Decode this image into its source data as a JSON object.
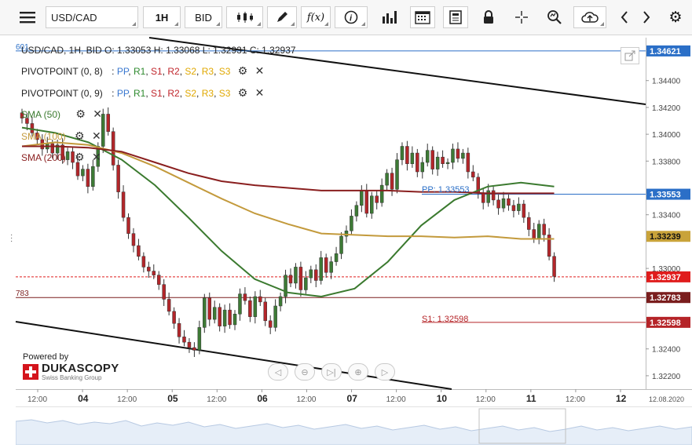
{
  "toolbar": {
    "symbol": "USD/CAD",
    "timeframe": "1H",
    "side": "BID",
    "fx_label": "f(x)"
  },
  "chart_header": {
    "info": "USD/CAD, 1H, BID   O: 1.33053 H: 1.33068 L: 1.32931 C: 1.32937",
    "pivot1_name": "PIVOTPOINT (0, 8)",
    "pivot2_name": "PIVOTPOINT (0, 9)",
    "pivot_levels": [
      {
        "label": "PP",
        "color": "#3a78d0"
      },
      {
        "label": "R1",
        "color": "#2f8a2f"
      },
      {
        "label": "S1",
        "color": "#c0262c"
      },
      {
        "label": "R2",
        "color": "#c0262c"
      },
      {
        "label": "S2",
        "color": "#e0a800"
      },
      {
        "label": "R3",
        "color": "#e0a800"
      },
      {
        "label": "S3",
        "color": "#e0a800"
      }
    ],
    "sma50": "SMA (50)",
    "sma100": "SMA (100)",
    "sma200": "SMA (200)"
  },
  "price_axis": {
    "ticks": [
      "1.34400",
      "1.34200",
      "1.34000",
      "1.33800",
      "1.33400",
      "1.33000",
      "1.32400",
      "1.32200"
    ],
    "tags": [
      {
        "text": "1.34621",
        "value": 1.34621,
        "bg": "#2b6fc7",
        "fg": "#ffffff"
      },
      {
        "text": "1.33553",
        "value": 1.33553,
        "bg": "#2b6fc7",
        "fg": "#ffffff"
      },
      {
        "text": "1.33239",
        "value": 1.33239,
        "bg": "#c9a33a",
        "fg": "#111111"
      },
      {
        "text": "1.32937",
        "value": 1.32937,
        "bg": "#e01c1c",
        "fg": "#ffffff"
      },
      {
        "text": "1.32783",
        "value": 1.32783,
        "bg": "#7a1d1d",
        "fg": "#ffffff"
      },
      {
        "text": "1.32598",
        "value": 1.32598,
        "bg": "#b52428",
        "fg": "#ffffff"
      }
    ]
  },
  "level_labels": {
    "pp": "PP: 1.33553",
    "s1": "S1: 1.32598",
    "left_cut_top": "601",
    "left_cut_mid": "783"
  },
  "time_axis": {
    "labels": [
      "12:00",
      "04",
      "12:00",
      "05",
      "12:00",
      "06",
      "12:00",
      "07",
      "12:00",
      "10",
      "12:00",
      "11",
      "12:00",
      "12"
    ],
    "date_right": "12.08.2020"
  },
  "branding": {
    "powered": "Powered by",
    "name": "DUKASCOPY",
    "sub": "Swiss Banking Group"
  },
  "chart_data": {
    "type": "candlestick",
    "title": "USD/CAD, 1H, BID",
    "ohlc_last": {
      "open": 1.33053,
      "high": 1.33068,
      "low": 1.32931,
      "close": 1.32937
    },
    "ylim": [
      1.321,
      1.3472
    ],
    "x_ticks": [
      "12:00",
      "04",
      "12:00",
      "05",
      "12:00",
      "06",
      "12:00",
      "07",
      "12:00",
      "10",
      "12:00",
      "11",
      "12:00",
      "12"
    ],
    "closes": [
      1.3412,
      1.3408,
      1.3401,
      1.3396,
      1.3389,
      1.3393,
      1.3386,
      1.3392,
      1.3381,
      1.3387,
      1.3379,
      1.3369,
      1.3374,
      1.3361,
      1.3376,
      1.3391,
      1.3415,
      1.3402,
      1.3377,
      1.3357,
      1.3338,
      1.3326,
      1.3317,
      1.3309,
      1.3301,
      1.3298,
      1.3295,
      1.3288,
      1.3277,
      1.3268,
      1.3259,
      1.3249,
      1.3245,
      1.3241,
      1.3239,
      1.3256,
      1.3278,
      1.3262,
      1.3271,
      1.3257,
      1.3269,
      1.3258,
      1.3266,
      1.3281,
      1.3276,
      1.3264,
      1.3279,
      1.3275,
      1.3261,
      1.3256,
      1.3272,
      1.3279,
      1.3295,
      1.3289,
      1.3301,
      1.3284,
      1.3293,
      1.3299,
      1.3291,
      1.3308,
      1.3297,
      1.3305,
      1.3311,
      1.3324,
      1.3328,
      1.3339,
      1.3347,
      1.3358,
      1.3341,
      1.3354,
      1.3349,
      1.3362,
      1.3371,
      1.3359,
      1.3381,
      1.3391,
      1.3378,
      1.3386,
      1.3372,
      1.3379,
      1.3388,
      1.3374,
      1.3383,
      1.3378,
      1.3379,
      1.3389,
      1.3382,
      1.3386,
      1.3372,
      1.3368,
      1.3356,
      1.3349,
      1.3358,
      1.3351,
      1.3345,
      1.3352,
      1.3347,
      1.3343,
      1.3348,
      1.3338,
      1.3329,
      1.3322,
      1.3333,
      1.3325,
      1.3309,
      1.3294
    ],
    "series": [
      {
        "name": "SMA (50)",
        "color": "#3b7a2f",
        "values": [
          1.3405,
          1.3401,
          1.3394,
          1.3381,
          1.3362,
          1.3338,
          1.3313,
          1.3292,
          1.3282,
          1.3279,
          1.3285,
          1.3305,
          1.3332,
          1.3351,
          1.3361,
          1.3364,
          1.3361
        ]
      },
      {
        "name": "SMA (100)",
        "color": "#c39a3c",
        "values": [
          1.3391,
          1.3394,
          1.3392,
          1.3386,
          1.3376,
          1.3364,
          1.3352,
          1.3341,
          1.3333,
          1.3326,
          1.3325,
          1.3324,
          1.3324,
          1.3323,
          1.3324,
          1.3322,
          1.3322
        ]
      },
      {
        "name": "SMA (200)",
        "color": "#8a1f1f",
        "values": [
          1.3391,
          1.3391,
          1.339,
          1.3387,
          1.3379,
          1.3371,
          1.3365,
          1.3362,
          1.336,
          1.3358,
          1.3358,
          1.3358,
          1.3357,
          1.3357,
          1.3356,
          1.3356,
          1.3356
        ]
      }
    ],
    "levels": [
      {
        "name": "PP",
        "value": 1.33553
      },
      {
        "name": "S1",
        "value": 1.32598
      },
      {
        "name": "R",
        "value": 1.34621
      },
      {
        "name": "S",
        "value": 1.32783
      }
    ]
  }
}
